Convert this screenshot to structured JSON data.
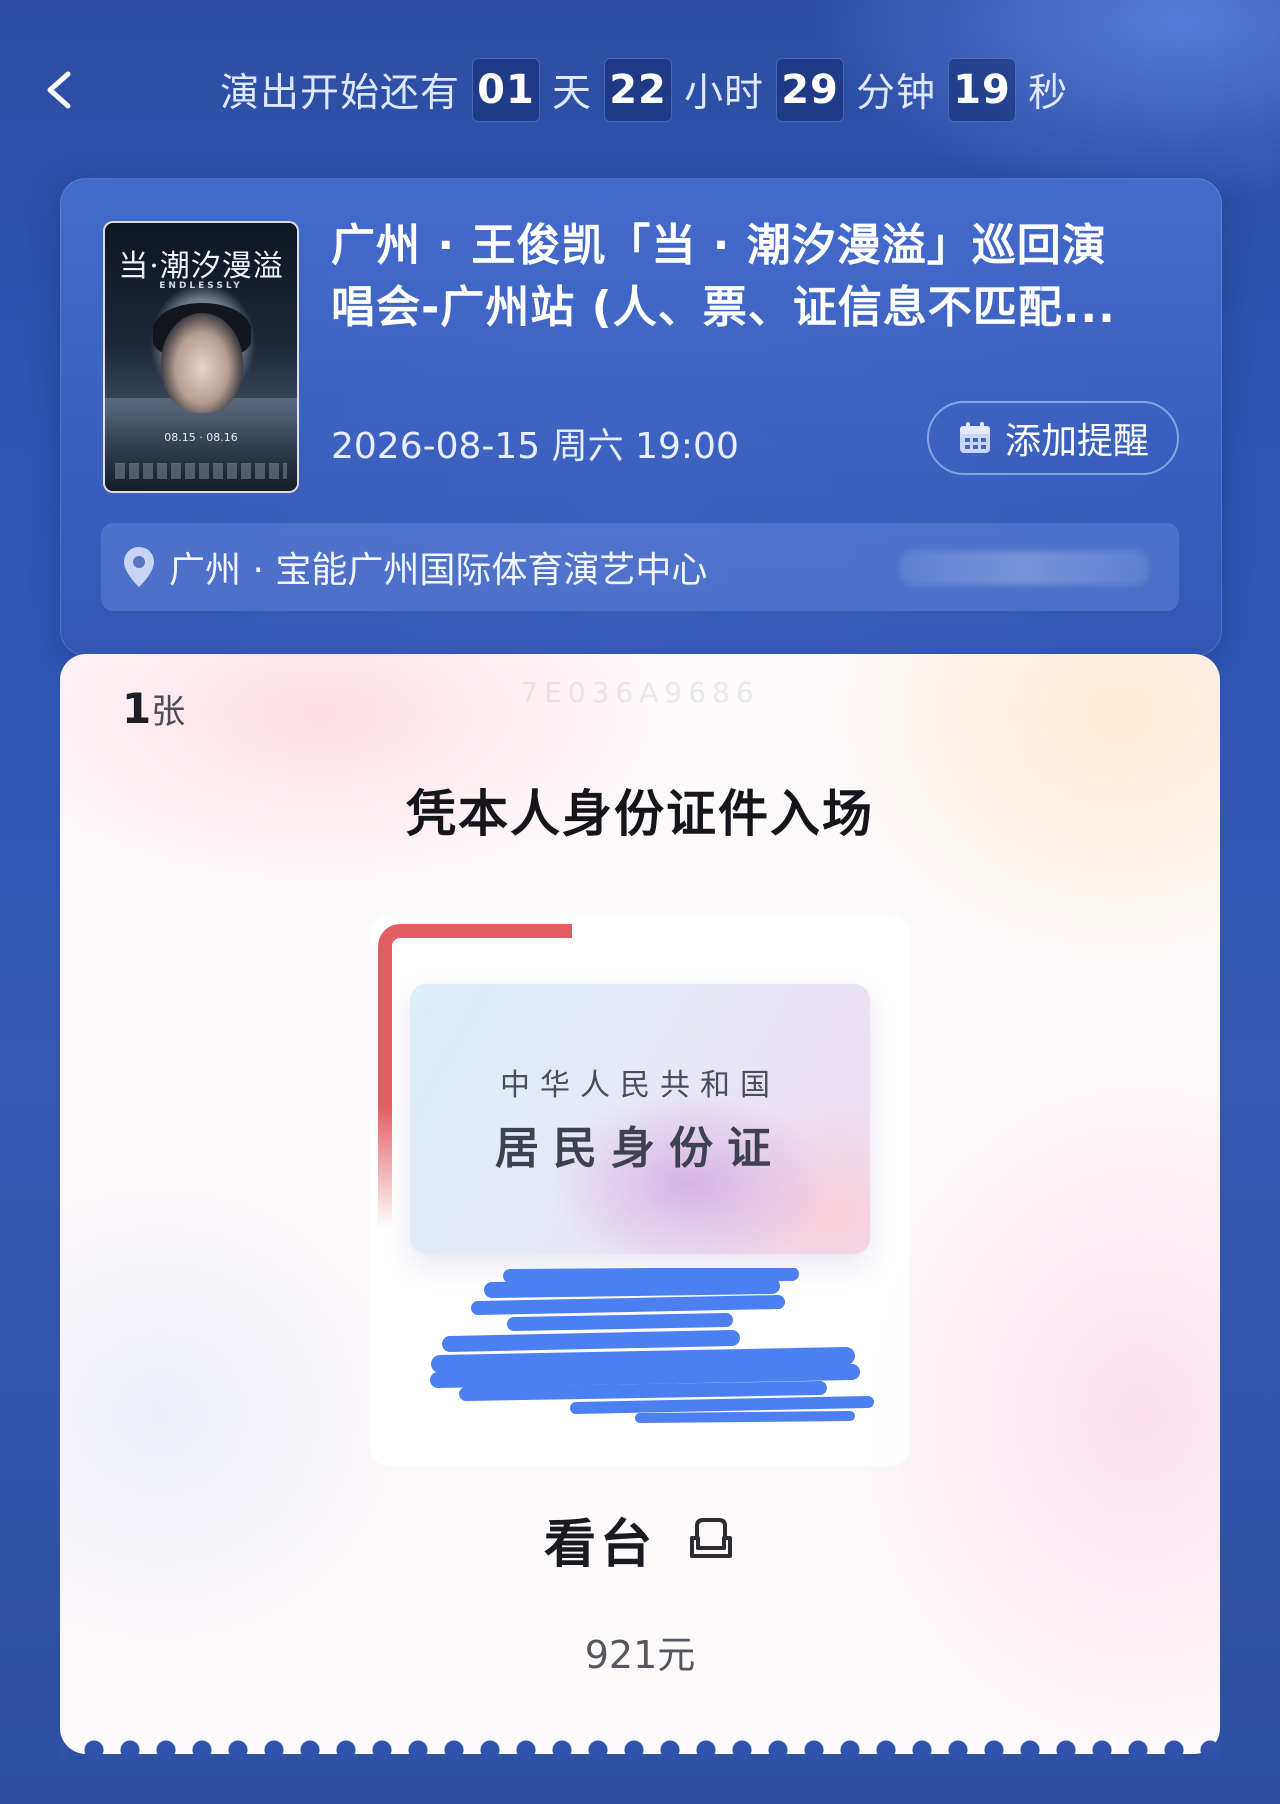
{
  "countdown": {
    "prefix": "演出开始还有",
    "days": "01",
    "days_unit": "天",
    "hours": "22",
    "hours_unit": "小时",
    "minutes": "29",
    "minutes_unit": "分钟",
    "seconds": "19",
    "seconds_unit": "秒"
  },
  "event": {
    "poster_title": "当·潮汐漫溢",
    "poster_subtitle": "ENDLESSLY",
    "poster_date": "08.15 · 08.16",
    "title_line1": "广州 · 王俊凯「当 · 潮汐漫溢」巡回演",
    "title_line2": "唱会-广州站 (人、票、证信息不匹配...",
    "datetime": "2026-08-15 周六 19:00",
    "reminder_label": "添加提醒",
    "venue": "广州 · 宝能广州国际体育演艺中心"
  },
  "ticket": {
    "code": "7E036A9686",
    "count": "1",
    "count_unit": "张",
    "entry_method": "凭本人身份证件入场",
    "id_country": "中华人民共和国",
    "id_type": "居民身份证",
    "seat_area": "看台",
    "price": "921元"
  },
  "colors": {
    "background": "#2f52ac",
    "accent_red": "#e2555c",
    "redaction_blue": "#4c7ff0"
  },
  "icons": {
    "back": "chevron-left-icon",
    "reminder": "calendar-icon",
    "venue": "location-pin-icon",
    "seat": "seat-icon"
  }
}
